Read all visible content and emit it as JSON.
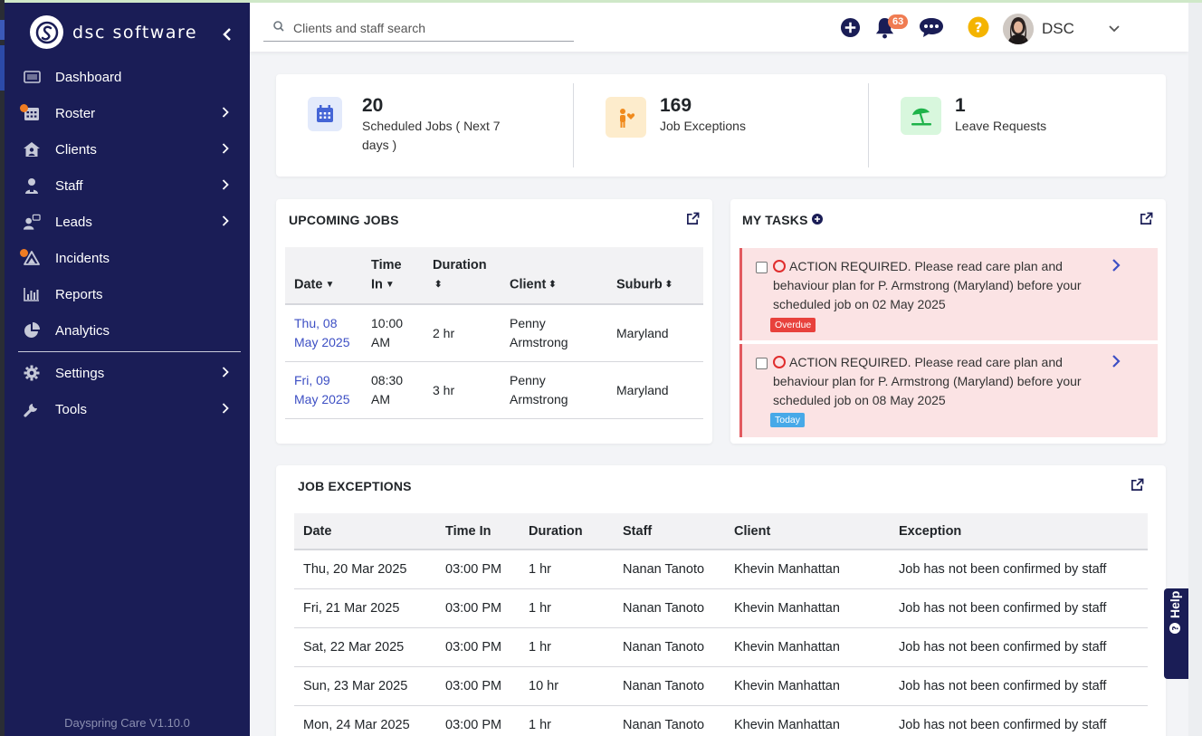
{
  "app": {
    "brand": "dsc software",
    "version": "Dayspring Care V1.10.0"
  },
  "sidebar": {
    "items": [
      {
        "label": "Dashboard",
        "icon": "dashboard-icon",
        "submenu": false,
        "dot": false
      },
      {
        "label": "Roster",
        "icon": "calendar-icon",
        "submenu": true,
        "dot": true
      },
      {
        "label": "Clients",
        "icon": "home-user-icon",
        "submenu": true,
        "dot": false
      },
      {
        "label": "Staff",
        "icon": "staff-icon",
        "submenu": true,
        "dot": false
      },
      {
        "label": "Leads",
        "icon": "leads-icon",
        "submenu": true,
        "dot": false
      },
      {
        "label": "Incidents",
        "icon": "warning-icon",
        "submenu": false,
        "dot": true
      },
      {
        "label": "Reports",
        "icon": "bar-chart-icon",
        "submenu": false,
        "dot": false
      },
      {
        "label": "Analytics",
        "icon": "pie-chart-icon",
        "submenu": false,
        "dot": false
      },
      {
        "label": "Settings",
        "icon": "gear-icon",
        "submenu": true,
        "dot": false
      },
      {
        "label": "Tools",
        "icon": "wrench-icon",
        "submenu": true,
        "dot": false
      }
    ]
  },
  "topbar": {
    "search_placeholder": "Clients and staff search",
    "notifications_count": "63",
    "user_name": "DSC"
  },
  "stats": [
    {
      "value": "20",
      "label": "Scheduled Jobs ( Next 7 days )",
      "icon": "calendar-icon",
      "color": "#4565d6",
      "bg": "#e3eafb"
    },
    {
      "value": "169",
      "label": "Job Exceptions",
      "icon": "person-heart-icon",
      "color": "#f08a1c",
      "bg": "#fdeccc"
    },
    {
      "value": "1",
      "label": "Leave Requests",
      "icon": "beach-umbrella-icon",
      "color": "#1fb34a",
      "bg": "#d8f7dd"
    }
  ],
  "upcoming_jobs": {
    "title": "UPCOMING JOBS",
    "columns": [
      "Date",
      "Time In",
      "Duration",
      "Client",
      "Suburb"
    ],
    "rows": [
      {
        "date": "Thu, 08 May 2025",
        "time": "10:00 AM",
        "duration": "2 hr",
        "client": "Penny Armstrong",
        "suburb": "Maryland"
      },
      {
        "date": "Fri, 09 May 2025",
        "time": "08:30 AM",
        "duration": "3 hr",
        "client": "Penny Armstrong",
        "suburb": "Maryland"
      }
    ]
  },
  "my_tasks": {
    "title": "MY TASKS",
    "items": [
      {
        "text": "ACTION REQUIRED. Please read care plan and behaviour plan for P. Armstrong (Maryland) before your scheduled job on 02 May 2025",
        "tag": "Overdue",
        "tag_color": "#e8413c"
      },
      {
        "text": "ACTION REQUIRED. Please read care plan and behaviour plan for P. Armstrong (Maryland) before your scheduled job on 08 May 2025",
        "tag": "Today",
        "tag_color": "#47a9e8"
      }
    ]
  },
  "job_exceptions": {
    "title": "JOB EXCEPTIONS",
    "columns": [
      "Date",
      "Time In",
      "Duration",
      "Staff",
      "Client",
      "Exception"
    ],
    "rows": [
      {
        "date": "Thu, 20 Mar 2025",
        "time": "03:00 PM",
        "duration": "1 hr",
        "staff": "Nanan Tanoto",
        "client": "Khevin Manhattan",
        "exception": "Job has not been confirmed by staff"
      },
      {
        "date": "Fri, 21 Mar 2025",
        "time": "03:00 PM",
        "duration": "1 hr",
        "staff": "Nanan Tanoto",
        "client": "Khevin Manhattan",
        "exception": "Job has not been confirmed by staff"
      },
      {
        "date": "Sat, 22 Mar 2025",
        "time": "03:00 PM",
        "duration": "1 hr",
        "staff": "Nanan Tanoto",
        "client": "Khevin Manhattan",
        "exception": "Job has not been confirmed by staff"
      },
      {
        "date": "Sun, 23 Mar 2025",
        "time": "03:00 PM",
        "duration": "10 hr",
        "staff": "Nanan Tanoto",
        "client": "Khevin Manhattan",
        "exception": "Job has not been confirmed by staff"
      },
      {
        "date": "Mon, 24 Mar 2025",
        "time": "03:00 PM",
        "duration": "1 hr",
        "staff": "Nanan Tanoto",
        "client": "Khevin Manhattan",
        "exception": "Job has not been confirmed by staff"
      }
    ]
  },
  "help": {
    "label": "Help"
  }
}
